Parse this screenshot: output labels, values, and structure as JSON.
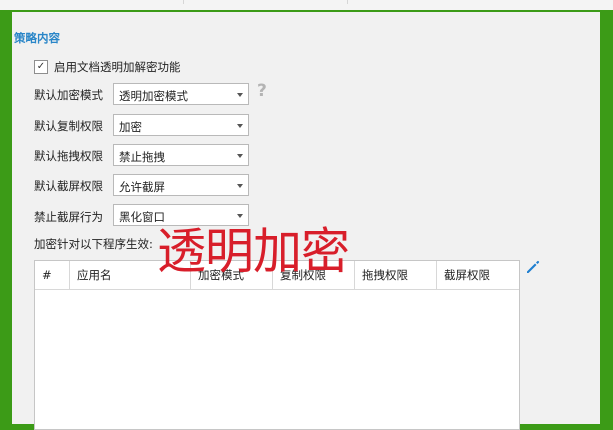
{
  "section_title": "策略内容",
  "enable_checkbox": {
    "checked": true,
    "mark": "✓",
    "label": "启用文档透明加解密功能"
  },
  "settings": [
    {
      "label": "默认加密模式",
      "value": "透明加密模式"
    },
    {
      "label": "默认复制权限",
      "value": "加密"
    },
    {
      "label": "默认拖拽权限",
      "value": "禁止拖拽"
    },
    {
      "label": "默认截屏权限",
      "value": "允许截屏"
    },
    {
      "label": "禁止截屏行为",
      "value": "黑化窗口"
    }
  ],
  "help_icon": {
    "glyph": "?"
  },
  "apply_label": "加密针对以下程序生效:",
  "table": {
    "columns": [
      "#",
      "应用名",
      "加密模式",
      "复制权限",
      "拖拽权限",
      "截屏权限"
    ]
  },
  "watermark": "透明加密",
  "colors": {
    "frame": "#3c9b17",
    "section_title": "#2a86c8",
    "watermark": "#d81e2a",
    "edit_icon": "#1f7fd0"
  }
}
